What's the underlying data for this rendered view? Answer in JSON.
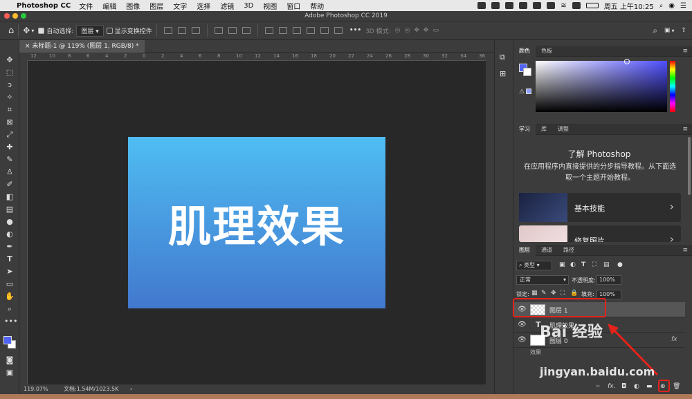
{
  "menubar": {
    "app_name": "Photoshop CC",
    "items": [
      "文件",
      "编辑",
      "图像",
      "图层",
      "文字",
      "选择",
      "滤镜",
      "3D",
      "视图",
      "窗口",
      "帮助"
    ],
    "clock": "周五 上午10:25"
  },
  "window": {
    "title": "Adobe Photoshop CC 2019"
  },
  "options_bar": {
    "auto_select_label": "自动选择:",
    "auto_select_value": "图层",
    "show_transform_label": "显示变换控件",
    "mode_3d_label": "3D 模式:"
  },
  "document": {
    "tab_title": "未标题-1 @ 119% (图层 1, RGB/8) *",
    "canvas_text": "肌理效果",
    "ruler_ticks": [
      "12",
      "10",
      "8",
      "6",
      "4",
      "2",
      "0",
      "2",
      "4",
      "6",
      "8",
      "10",
      "12",
      "14",
      "16",
      "18",
      "20",
      "22",
      "24",
      "26",
      "28",
      "30",
      "32",
      "34",
      "36"
    ]
  },
  "status_bar": {
    "zoom": "119.07%",
    "doc_info": "文档:1.54M/1023.5K"
  },
  "panels": {
    "color": {
      "tabs": [
        "颜色",
        "色板"
      ],
      "fg_color": "#4f64f5",
      "bg_color": "#ffffff"
    },
    "learn": {
      "tabs": [
        "学习",
        "库",
        "调整"
      ],
      "heading": "了解 Photoshop",
      "description": "在应用程序内直接提供的分步指导教程。从下面选取一个主题开始教程。",
      "cards": [
        {
          "label": "基本技能"
        },
        {
          "label": "修复照片"
        }
      ]
    },
    "layers": {
      "tabs": [
        "图层",
        "通道",
        "路径"
      ],
      "filter_label": "类型",
      "blend_mode": "正常",
      "opacity_label": "不透明度:",
      "opacity_value": "100%",
      "lock_label": "锁定:",
      "fill_label": "填充:",
      "fill_value": "100%",
      "rows": [
        {
          "name": "图层 1",
          "kind": "pixel"
        },
        {
          "name": "肌理效果",
          "kind": "text"
        },
        {
          "name": "图层 0",
          "kind": "pixel",
          "fx": "fx"
        }
      ],
      "effects_label": "效果",
      "fx_footer": "fx."
    }
  },
  "watermark": {
    "line1": "Bai 经验",
    "line2": "jingyan.baidu.com"
  },
  "accent": {
    "highlight": "#e6231b"
  }
}
